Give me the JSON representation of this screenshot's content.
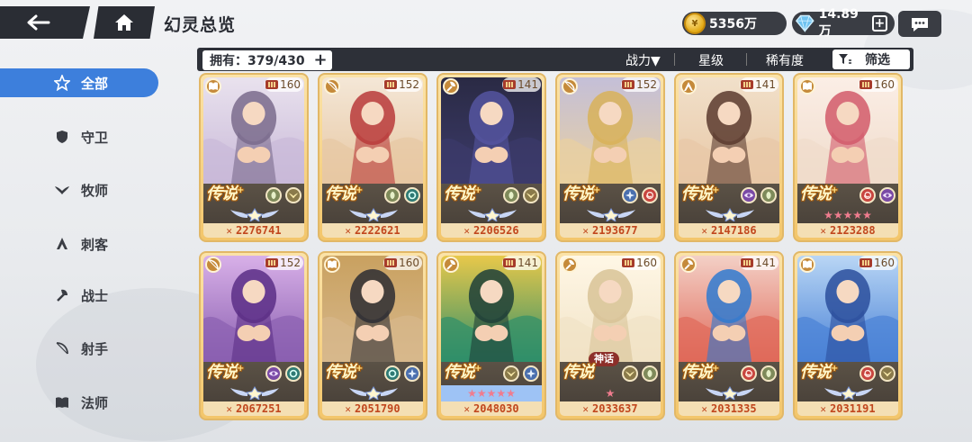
{
  "header": {
    "title": "幻灵总览",
    "gold": "5356万",
    "gems": "14.89万",
    "plus": "+"
  },
  "sidebar": {
    "items": [
      {
        "label": "全部",
        "icon": "star-outline-icon",
        "active": true
      },
      {
        "label": "守卫",
        "icon": "shield-icon",
        "active": false
      },
      {
        "label": "牧师",
        "icon": "wings-icon",
        "active": false
      },
      {
        "label": "刺客",
        "icon": "assassin-icon",
        "active": false
      },
      {
        "label": "战士",
        "icon": "axe-icon",
        "active": false
      },
      {
        "label": "射手",
        "icon": "bow-icon",
        "active": false
      },
      {
        "label": "法师",
        "icon": "book-icon",
        "active": false
      }
    ]
  },
  "filterbar": {
    "owned": "拥有：379/430",
    "sort_power": "战力▼",
    "sort_star": "星级",
    "sort_rarity": "稀有度",
    "filter_label": "筛选"
  },
  "cards": [
    {
      "level": "160",
      "power": "2276741",
      "rarity": "传说",
      "rarity_sup": "+",
      "class": "book",
      "elements": [
        "leaf",
        "wing"
      ],
      "stars": "wing",
      "palette": [
        "#c9b9d8",
        "#7a6b8c",
        "#e9e2ee"
      ]
    },
    {
      "level": "152",
      "power": "2222621",
      "rarity": "传说",
      "rarity_sup": "+",
      "class": "bow",
      "elements": [
        "leaf",
        "swirl"
      ],
      "stars": "wing",
      "palette": [
        "#e7c7a2",
        "#b93a3a",
        "#f4e7d7"
      ]
    },
    {
      "level": "141",
      "power": "2206526",
      "rarity": "传说",
      "rarity_sup": "+",
      "class": "axe",
      "elements": [
        "leaf",
        "wing"
      ],
      "stars": "wing",
      "palette": [
        "#3c3b6b",
        "#5555a0",
        "#2a2a44"
      ]
    },
    {
      "level": "152",
      "power": "2193677",
      "rarity": "传说",
      "rarity_sup": "+",
      "class": "bow",
      "elements": [
        "spark",
        "spiral"
      ],
      "stars": "wing",
      "palette": [
        "#e9d0a0",
        "#d8b259",
        "#c4bfd8"
      ]
    },
    {
      "level": "141",
      "power": "2147186",
      "rarity": "传说",
      "rarity_sup": "+",
      "class": "assassin",
      "elements": [
        "eye",
        "leaf"
      ],
      "stars": "wing",
      "palette": [
        "#e8c8a6",
        "#5a3a2e",
        "#f1e0ca"
      ]
    },
    {
      "level": "160",
      "power": "2123288",
      "rarity": "传说",
      "rarity_sup": "+",
      "class": "book",
      "elements": [
        "spiral",
        "eye"
      ],
      "stars": "★★★★★",
      "palette": [
        "#f0dccb",
        "#d25a6a",
        "#fbeee6"
      ]
    },
    {
      "level": "152",
      "power": "2067251",
      "rarity": "传说",
      "rarity_sup": "+",
      "class": "bow",
      "elements": [
        "eye",
        "swirl"
      ],
      "stars": "wing",
      "palette": [
        "#8a5fb0",
        "#5b2e86",
        "#d8b0e8"
      ]
    },
    {
      "level": "160",
      "power": "2051790",
      "rarity": "传说",
      "rarity_sup": "+",
      "class": "book",
      "elements": [
        "swirl",
        "spark"
      ],
      "stars": "wing",
      "palette": [
        "#d7b88c",
        "#2d2d33",
        "#c9a160"
      ]
    },
    {
      "level": "141",
      "power": "2048030",
      "rarity": "传说",
      "rarity_sup": "+",
      "class": "axe",
      "elements": [
        "wing",
        "spark"
      ],
      "stars": "★★★★★",
      "stars_blue": true,
      "palette": [
        "#2f8f6a",
        "#1f3f38",
        "#e8c84a"
      ]
    },
    {
      "level": "160",
      "power": "2033637",
      "rarity": "传说",
      "rarity_sup": "",
      "myth": "神话",
      "class": "axe",
      "elements": [
        "wing",
        "leaf"
      ],
      "stars": "★",
      "palette": [
        "#f1e3c6",
        "#d8c397",
        "#fff7e6"
      ]
    },
    {
      "level": "141",
      "power": "2031335",
      "rarity": "传说",
      "rarity_sup": "+",
      "class": "axe",
      "elements": [
        "spiral",
        "leaf"
      ],
      "stars": "wing",
      "palette": [
        "#e06a5a",
        "#2f7ad0",
        "#f3d0c6"
      ]
    },
    {
      "level": "160",
      "power": "2031191",
      "rarity": "传说",
      "rarity_sup": "+",
      "class": "book",
      "elements": [
        "spiral",
        "wing"
      ],
      "stars": "wing",
      "palette": [
        "#4a82d6",
        "#2b4f9c",
        "#b9d6f5"
      ]
    }
  ],
  "colors": {
    "accent": "#3d7fdc",
    "dark": "#2d3038",
    "power_text": "#c1471e",
    "card_gold": "#f3c66b"
  }
}
